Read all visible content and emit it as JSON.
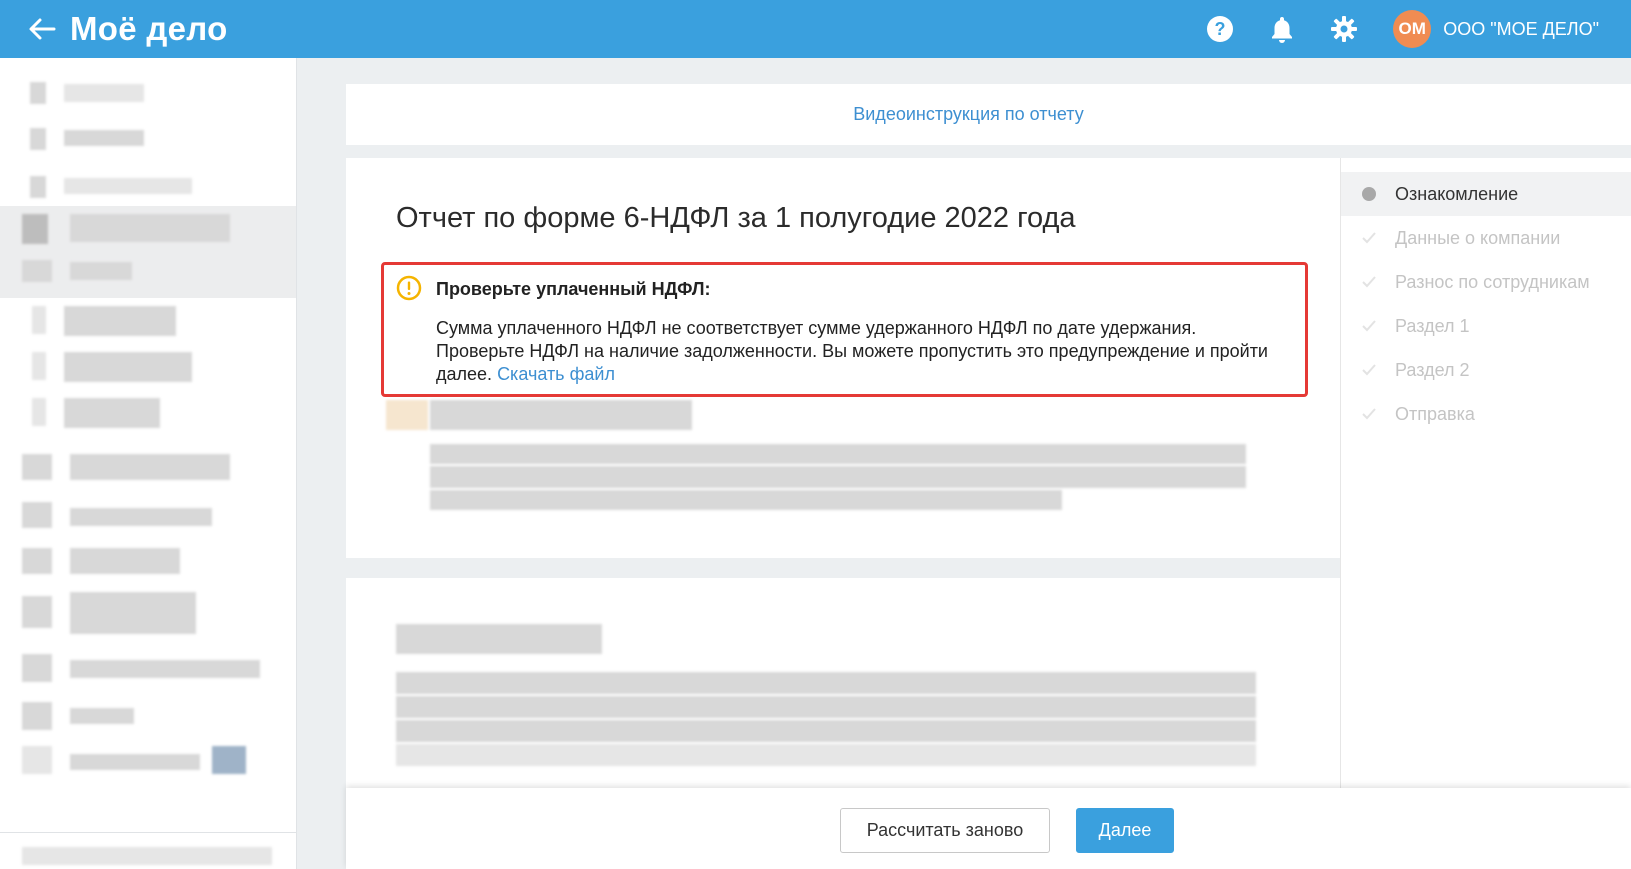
{
  "header": {
    "logo": "Моё дело",
    "company_initials": "ОМ",
    "company_name": "ООО \"МОЕ ДЕЛО\""
  },
  "video_link": "Видеоинструкция по отчету",
  "page_title": "Отчет по форме 6-НДФЛ за 1 полугодие 2022 года",
  "warning": {
    "title": "Проверьте уплаченный НДФЛ:",
    "text": "Сумма уплаченного НДФЛ не соответствует сумме удержанного НДФЛ по дате удержания. Проверьте НДФЛ на наличие задолженности. Вы можете пропустить это предупреждение и пройти далее.",
    "link": "Скачать файл"
  },
  "steps": [
    {
      "label": "Ознакомление",
      "state": "current"
    },
    {
      "label": "Данные о компании",
      "state": "pending"
    },
    {
      "label": "Разнос по сотрудникам",
      "state": "pending"
    },
    {
      "label": "Раздел 1",
      "state": "pending"
    },
    {
      "label": "Раздел 2",
      "state": "pending"
    },
    {
      "label": "Отправка",
      "state": "pending"
    }
  ],
  "footer": {
    "recalc_label": "Рассчитать заново",
    "next_label": "Далее"
  },
  "colors": {
    "topbar": "#3aa0de",
    "link": "#3d8fd1",
    "warning_border": "#e53935",
    "warning_icon": "#f5b400",
    "avatar": "#f08c52"
  }
}
